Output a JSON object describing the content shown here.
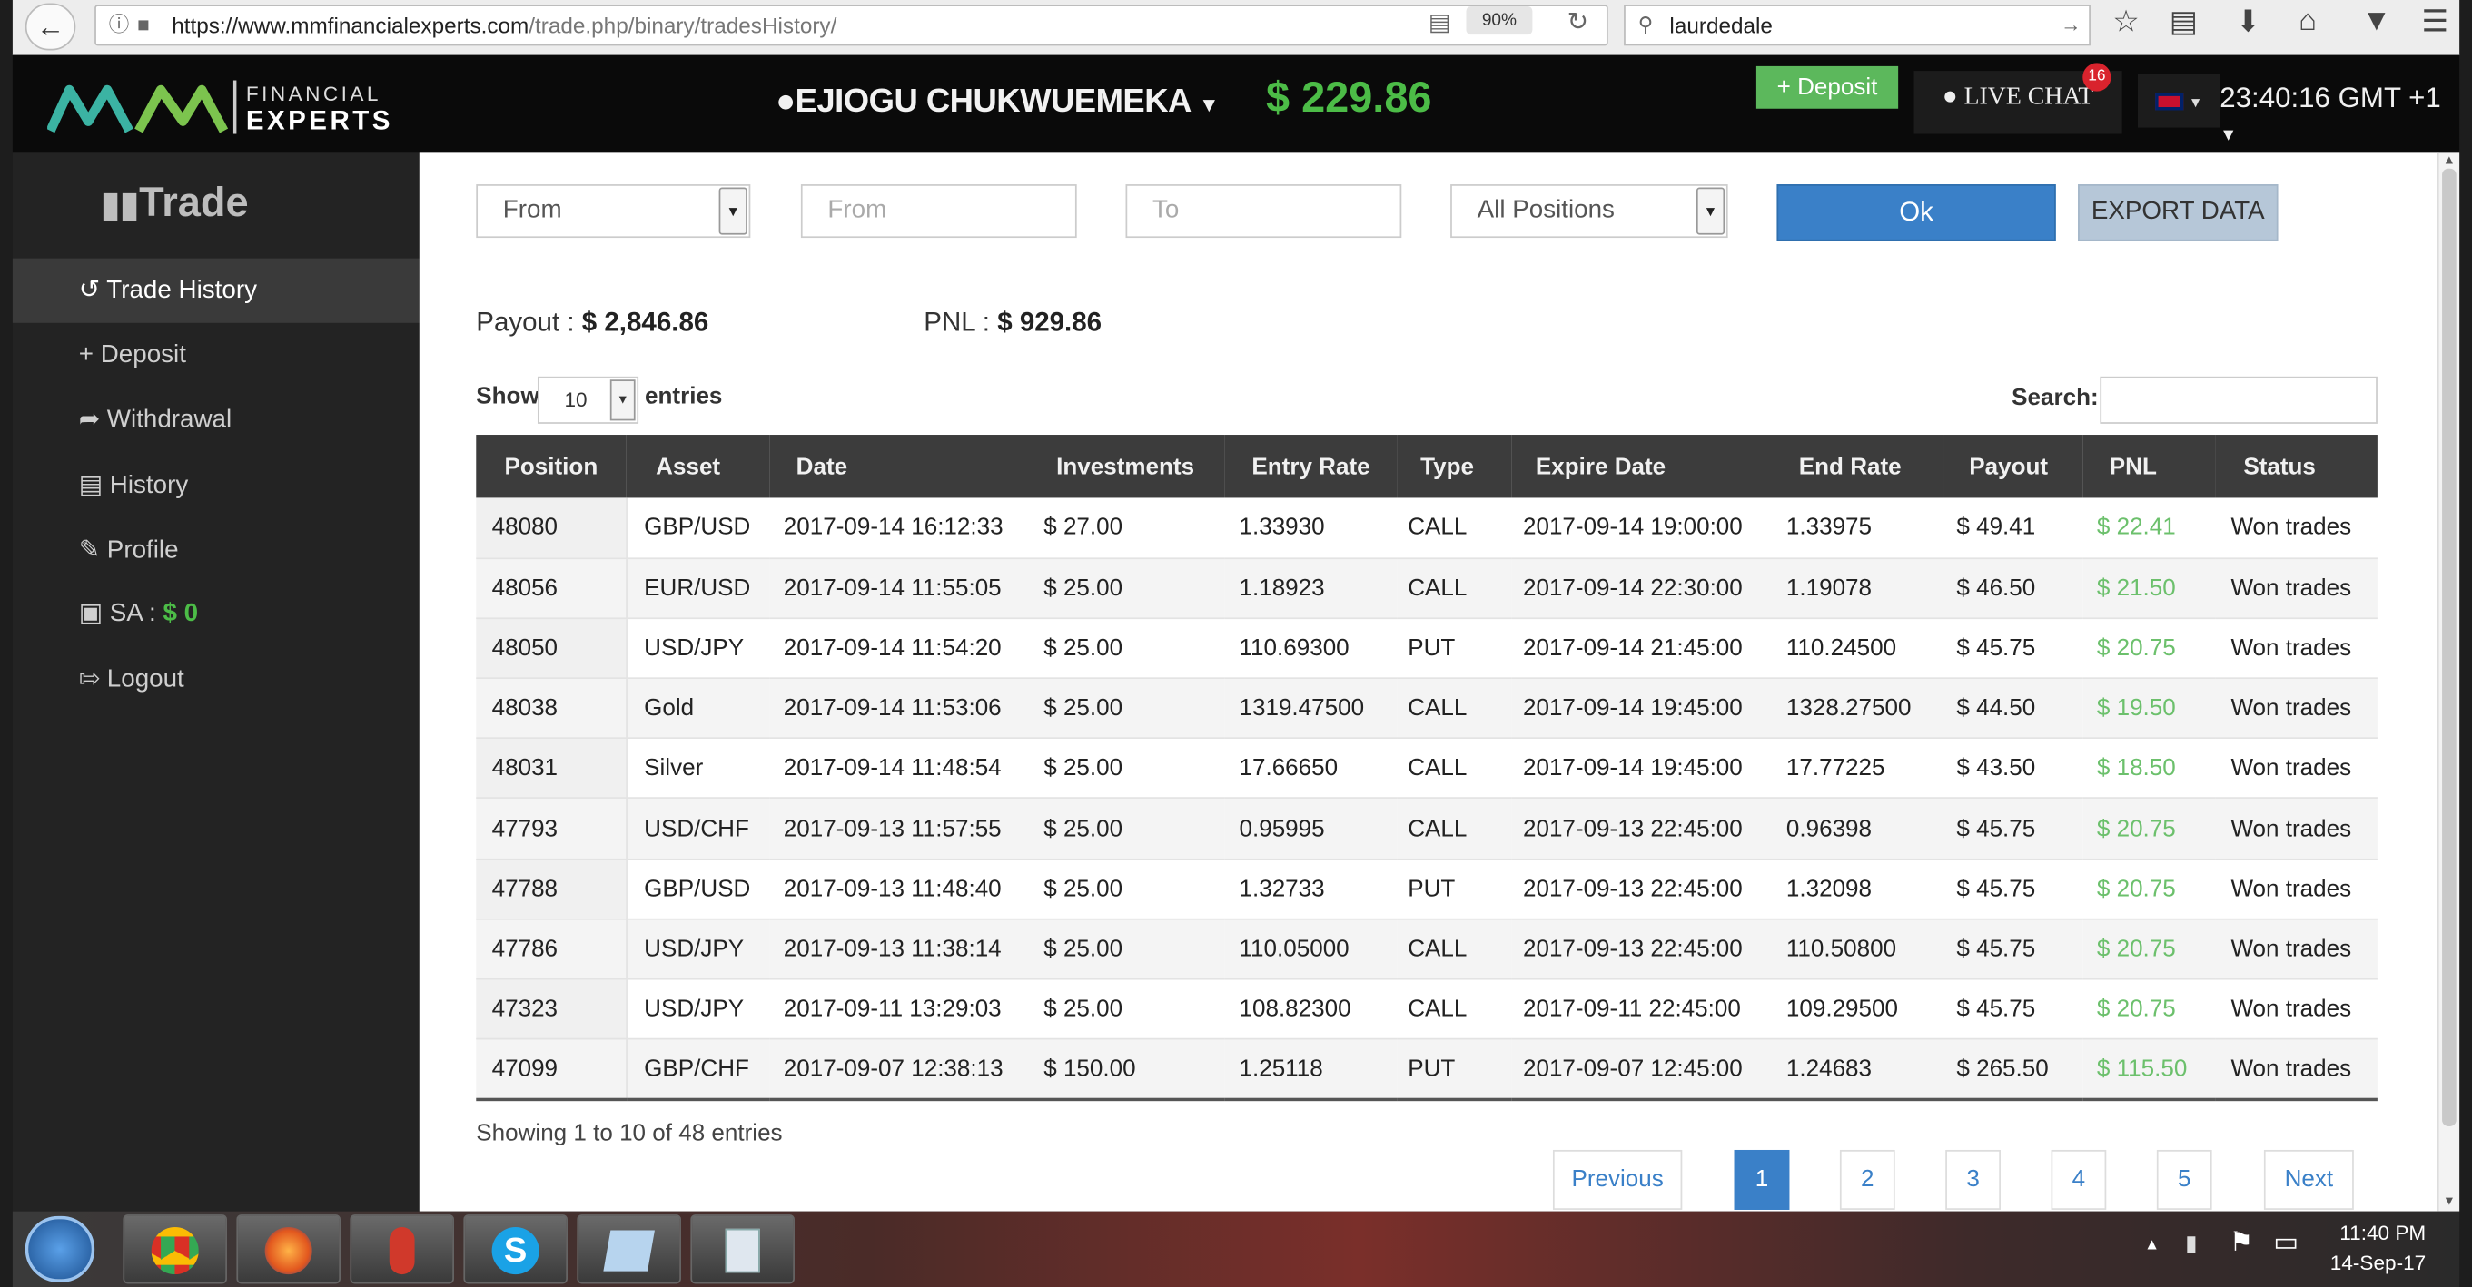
{
  "browser": {
    "url_host": "https://www.mmfinancialexperts.com",
    "url_path": "/trade.php/binary/tradesHistory/",
    "zoom": "90%",
    "search_query": "laurdedale"
  },
  "header": {
    "logo_line1": "FINANCIAL",
    "logo_line2": "EXPERTS",
    "user_name": "EJIOGU CHUKWUEMEKA",
    "balance": "$ 229.86",
    "deposit_label": "Deposit",
    "live_chat_label": "LIVE CHAT",
    "chat_badge": "16",
    "clock": "23:40:16 GMT +1"
  },
  "sidebar": {
    "title": "Trade",
    "items": [
      {
        "label": "Trade History",
        "icon": "history-icon"
      },
      {
        "label": "Deposit",
        "icon": "plus-icon"
      },
      {
        "label": "Withdrawal",
        "icon": "share-icon"
      },
      {
        "label": "History",
        "icon": "card-icon"
      },
      {
        "label": "Profile",
        "icon": "edit-icon"
      },
      {
        "label": "SA : ",
        "value": "$ 0",
        "icon": "briefcase-icon"
      },
      {
        "label": "Logout",
        "icon": "logout-icon"
      }
    ]
  },
  "filters": {
    "from_select": "From",
    "from_placeholder": "From",
    "to_placeholder": "To",
    "positions_select": "All Positions",
    "ok_label": "Ok",
    "export_label": "EXPORT DATA"
  },
  "summary": {
    "payout_label": "Payout : ",
    "payout_value": "$ 2,846.86",
    "pnl_label": "PNL : ",
    "pnl_value": "$ 929.86"
  },
  "table_controls": {
    "show_label": "Show",
    "entries_value": "10",
    "entries_label": "entries",
    "search_label": "Search:"
  },
  "table": {
    "columns": [
      "Position",
      "Asset",
      "Date",
      "Investments",
      "Entry Rate",
      "Type",
      "Expire Date",
      "End Rate",
      "Payout",
      "PNL",
      "Status"
    ],
    "rows": [
      [
        "48080",
        "GBP/USD",
        "2017-09-14 16:12:33",
        "$ 27.00",
        "1.33930",
        "CALL",
        "2017-09-14 19:00:00",
        "1.33975",
        "$ 49.41",
        "$ 22.41",
        "Won trades"
      ],
      [
        "48056",
        "EUR/USD",
        "2017-09-14 11:55:05",
        "$ 25.00",
        "1.18923",
        "CALL",
        "2017-09-14 22:30:00",
        "1.19078",
        "$ 46.50",
        "$ 21.50",
        "Won trades"
      ],
      [
        "48050",
        "USD/JPY",
        "2017-09-14 11:54:20",
        "$ 25.00",
        "110.69300",
        "PUT",
        "2017-09-14 21:45:00",
        "110.24500",
        "$ 45.75",
        "$ 20.75",
        "Won trades"
      ],
      [
        "48038",
        "Gold",
        "2017-09-14 11:53:06",
        "$ 25.00",
        "1319.47500",
        "CALL",
        "2017-09-14 19:45:00",
        "1328.27500",
        "$ 44.50",
        "$ 19.50",
        "Won trades"
      ],
      [
        "48031",
        "Silver",
        "2017-09-14 11:48:54",
        "$ 25.00",
        "17.66650",
        "CALL",
        "2017-09-14 19:45:00",
        "17.77225",
        "$ 43.50",
        "$ 18.50",
        "Won trades"
      ],
      [
        "47793",
        "USD/CHF",
        "2017-09-13 11:57:55",
        "$ 25.00",
        "0.95995",
        "CALL",
        "2017-09-13 22:45:00",
        "0.96398",
        "$ 45.75",
        "$ 20.75",
        "Won trades"
      ],
      [
        "47788",
        "GBP/USD",
        "2017-09-13 11:48:40",
        "$ 25.00",
        "1.32733",
        "PUT",
        "2017-09-13 22:45:00",
        "1.32098",
        "$ 45.75",
        "$ 20.75",
        "Won trades"
      ],
      [
        "47786",
        "USD/JPY",
        "2017-09-13 11:38:14",
        "$ 25.00",
        "110.05000",
        "CALL",
        "2017-09-13 22:45:00",
        "110.50800",
        "$ 45.75",
        "$ 20.75",
        "Won trades"
      ],
      [
        "47323",
        "USD/JPY",
        "2017-09-11 13:29:03",
        "$ 25.00",
        "108.82300",
        "CALL",
        "2017-09-11 22:45:00",
        "109.29500",
        "$ 45.75",
        "$ 20.75",
        "Won trades"
      ],
      [
        "47099",
        "GBP/CHF",
        "2017-09-07 12:38:13",
        "$ 150.00",
        "1.25118",
        "PUT",
        "2017-09-07 12:45:00",
        "1.24683",
        "$ 265.50",
        "$ 115.50",
        "Won trades"
      ]
    ]
  },
  "footer": {
    "showing": "Showing 1 to 10 of 48 entries",
    "previous": "Previous",
    "pages": [
      "1",
      "2",
      "3",
      "4",
      "5"
    ],
    "next": "Next"
  },
  "taskbar": {
    "time": "11:40 PM",
    "date": "14-Sep-17"
  },
  "colors": {
    "accent_green": "#4cbc47",
    "pnl_green": "#6cc06c",
    "primary_blue": "#3a80c8"
  }
}
